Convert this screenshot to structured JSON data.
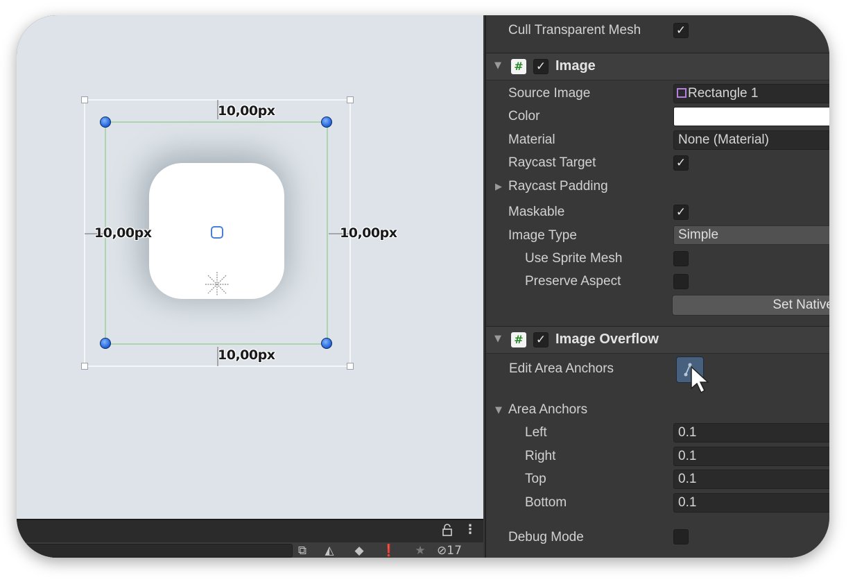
{
  "scene": {
    "top_label": "10,00px",
    "left_label": "10,00px",
    "right_label": "10,00px",
    "bottom_label": "10,00px"
  },
  "bottom_bar": {
    "lock_icon": "lock-icon",
    "menu_icon": "kebab-menu-icon",
    "hidden_count": "17"
  },
  "inspector": {
    "cull_transparent_mesh": {
      "label": "Cull Transparent Mesh",
      "checked": true
    },
    "image_component": {
      "title": "Image",
      "enabled": true,
      "source_image": {
        "label": "Source Image",
        "value": "Rectangle 1"
      },
      "color": {
        "label": "Color",
        "value": "#ffffff"
      },
      "material": {
        "label": "Material",
        "value": "None (Material)"
      },
      "raycast_target": {
        "label": "Raycast Target",
        "checked": true
      },
      "raycast_padding": {
        "label": "Raycast Padding"
      },
      "maskable": {
        "label": "Maskable",
        "checked": true
      },
      "image_type": {
        "label": "Image Type",
        "value": "Simple"
      },
      "use_sprite_mesh": {
        "label": "Use Sprite Mesh",
        "checked": false
      },
      "preserve_aspect": {
        "label": "Preserve Aspect",
        "checked": false
      },
      "set_native_button": "Set Native"
    },
    "overflow_component": {
      "title": "Image Overflow",
      "enabled": true,
      "edit_area_anchors": {
        "label": "Edit Area Anchors"
      },
      "area_anchors": {
        "label": "Area Anchors",
        "left": {
          "label": "Left",
          "value": "0.1"
        },
        "right": {
          "label": "Right",
          "value": "0.1"
        },
        "top": {
          "label": "Top",
          "value": "0.1"
        },
        "bottom": {
          "label": "Bottom",
          "value": "0.1"
        }
      },
      "debug_mode": {
        "label": "Debug Mode",
        "checked": false
      }
    }
  },
  "check_glyph": "✓"
}
